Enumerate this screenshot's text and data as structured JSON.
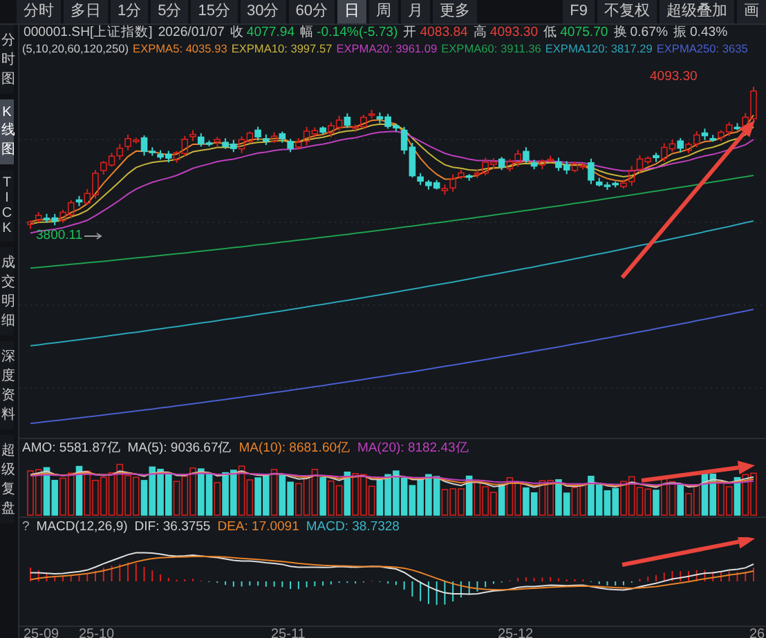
{
  "period_tabs": [
    {
      "label": "分时",
      "selected": false
    },
    {
      "label": "多日",
      "selected": false
    },
    {
      "label": "1分",
      "selected": false
    },
    {
      "label": "5分",
      "selected": false
    },
    {
      "label": "15分",
      "selected": false
    },
    {
      "label": "30分",
      "selected": false
    },
    {
      "label": "60分",
      "selected": false
    },
    {
      "label": "日",
      "selected": true
    },
    {
      "label": "周",
      "selected": false
    },
    {
      "label": "月",
      "selected": false
    },
    {
      "label": "更多",
      "selected": false
    }
  ],
  "toolbar_buttons": [
    "F9",
    "不复权",
    "超级叠加",
    "画"
  ],
  "side_tabs": [
    {
      "label": "分时图",
      "selected": false
    },
    {
      "label": "K线图",
      "selected": true
    },
    {
      "label": "TICK",
      "selected": false
    },
    {
      "label": "成交明细",
      "selected": false
    },
    {
      "label": "深度资料",
      "selected": false
    },
    {
      "label": "超级复盘",
      "selected": false
    }
  ],
  "quote": {
    "symbol": "000001.SH[上证指数]",
    "date": "2026/01/07",
    "fields": [
      {
        "label": "收",
        "value": "4077.94",
        "color": "#1ec25a"
      },
      {
        "label": "幅",
        "value": "-0.14%(-5.73)",
        "color": "#1ec25a"
      },
      {
        "label": "开",
        "value": "4083.84",
        "color": "#e8403a"
      },
      {
        "label": "高",
        "value": "4093.30",
        "color": "#e8403a"
      },
      {
        "label": "低",
        "value": "4075.70",
        "color": "#1ec25a"
      },
      {
        "label": "换",
        "value": "0.67%",
        "color": "#c8c8c8"
      },
      {
        "label": "振",
        "value": "0.43%",
        "color": "#c8c8c8"
      }
    ]
  },
  "price_chart": {
    "params": "(5,10,20,60,120,250)",
    "indicators": [
      {
        "text": "EXPMA5: 4035.93",
        "color": "#e8832a"
      },
      {
        "text": "EXPMA10: 3997.57",
        "color": "#c8b43c"
      },
      {
        "text": "EXPMA20: 3961.09",
        "color": "#c040c0"
      },
      {
        "text": "EXPMA60: 3911.36",
        "color": "#1fa050"
      },
      {
        "text": "EXPMA120: 3817.29",
        "color": "#2aa6b8"
      },
      {
        "text": "EXPMA250: 3635",
        "color": "#4a5fd0"
      }
    ],
    "high_label": "4093.30",
    "low_label": "3800.11"
  },
  "volume": {
    "indicators": [
      {
        "text": "AMO: 5581.87亿",
        "color": "#d0d0d0"
      },
      {
        "text": "MA(5): 9036.67亿",
        "color": "#d0d0d0"
      },
      {
        "text": "MA(10): 8681.60亿",
        "color": "#e8832a"
      },
      {
        "text": "MA(20): 8182.43亿",
        "color": "#c040c0"
      }
    ]
  },
  "macd": {
    "help": "?",
    "indicators": [
      {
        "text": "MACD(12,26,9)",
        "color": "#d0d0d0"
      },
      {
        "text": "DIF: 36.3755",
        "color": "#d0d0d0"
      },
      {
        "text": "DEA: 17.0091",
        "color": "#e8832a"
      },
      {
        "text": "MACD: 38.7328",
        "color": "#3ab8c8"
      }
    ]
  },
  "date_axis": [
    "25-09",
    "25-10",
    "25-11",
    "25-12",
    "26"
  ]
}
